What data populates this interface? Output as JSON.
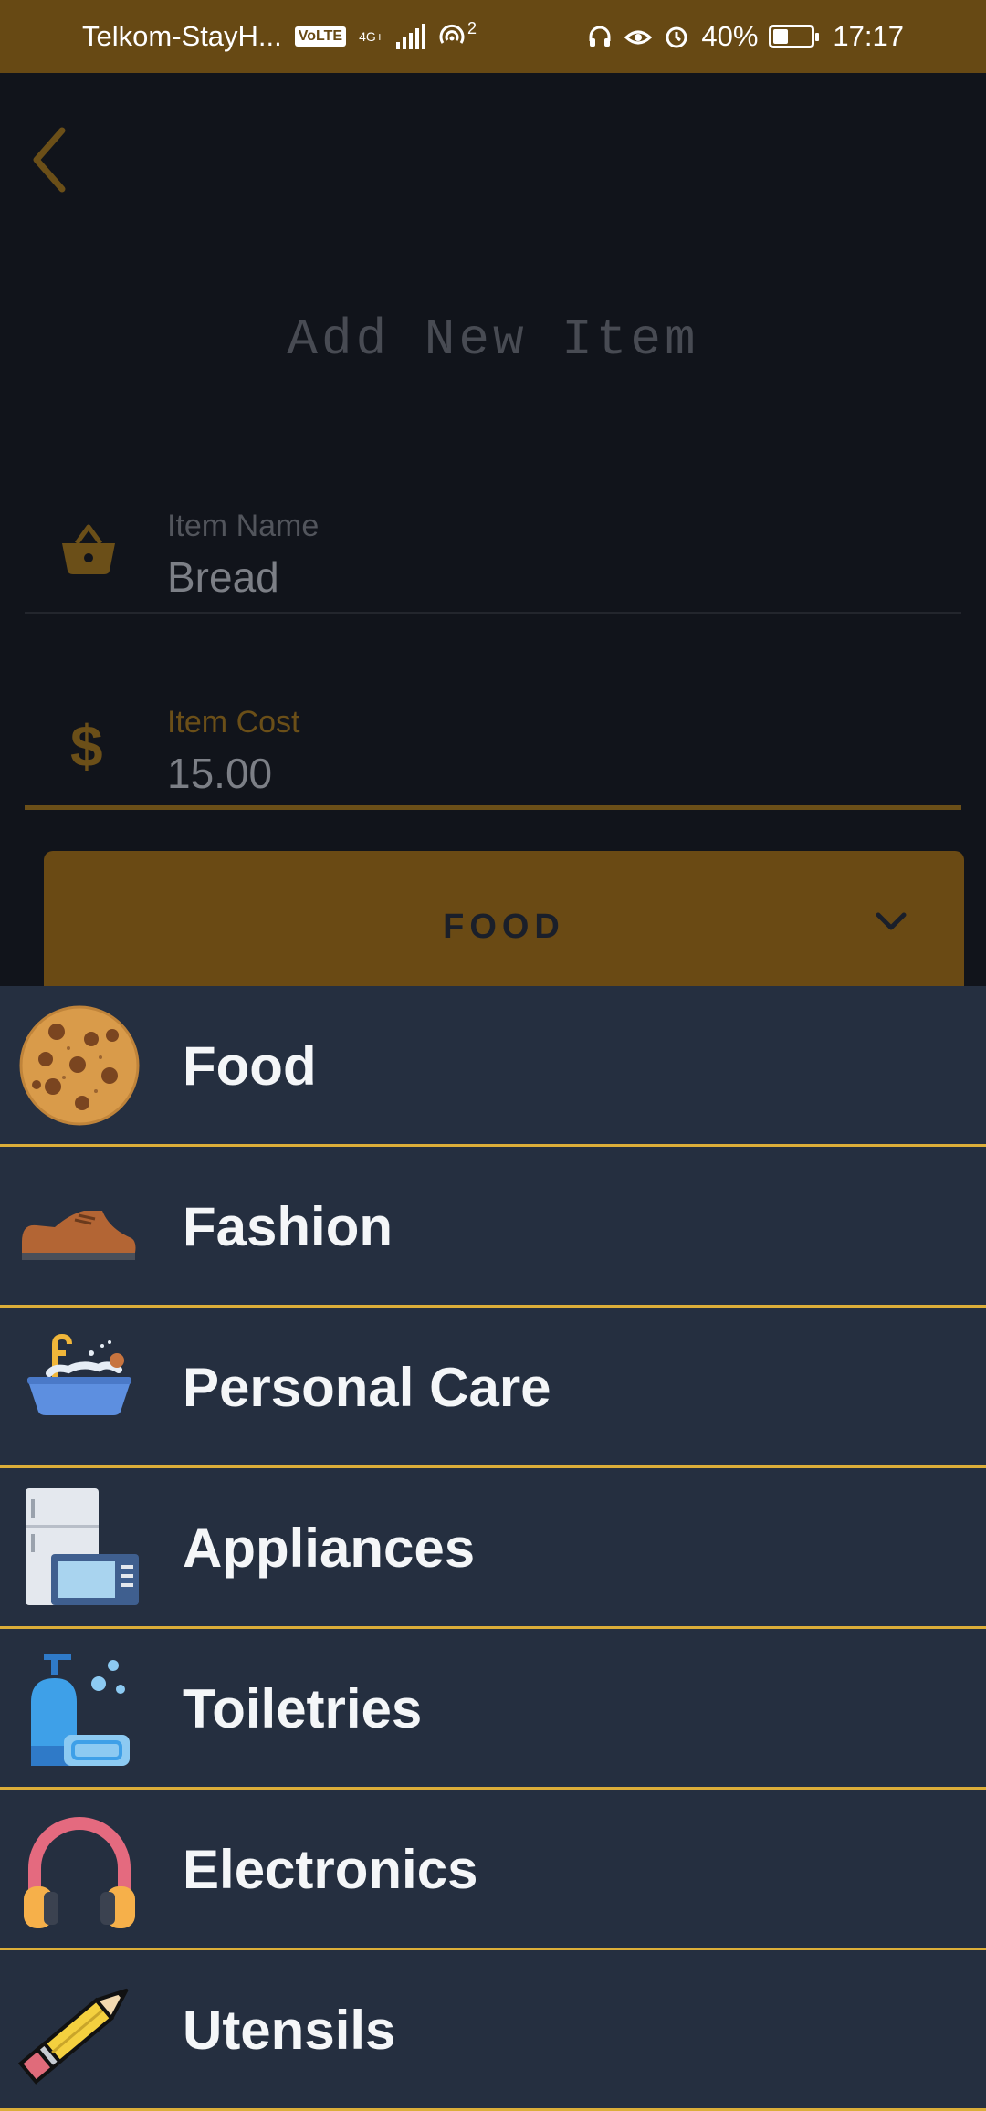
{
  "status_bar": {
    "carrier": "Telkom-StayH...",
    "volte": "VoLTE",
    "network": "4G+",
    "hotspot_count": "2",
    "battery": "40%",
    "battery_level": 0.4,
    "time": "17:17"
  },
  "page": {
    "title": "Add New Item"
  },
  "form": {
    "item_name": {
      "label": "Item Name",
      "value": "Bread",
      "icon": "basket-icon"
    },
    "item_cost": {
      "label": "Item Cost",
      "value": "15.00",
      "icon": "dollar-icon",
      "symbol": "$"
    }
  },
  "category_dropdown": {
    "selected": "FOOD"
  },
  "categories": [
    {
      "label": "Food",
      "icon": "cookie-icon"
    },
    {
      "label": "Fashion",
      "icon": "shoe-icon"
    },
    {
      "label": "Personal Care",
      "icon": "wash-basin-icon"
    },
    {
      "label": "Appliances",
      "icon": "fridge-microwave-icon"
    },
    {
      "label": "Toiletries",
      "icon": "soap-dispenser-icon"
    },
    {
      "label": "Electronics",
      "icon": "headphones-icon"
    },
    {
      "label": "Utensils",
      "icon": "pencil-icon"
    }
  ],
  "colors": {
    "accent": "#dcae39",
    "status_bar": "#674914",
    "background": "#11141b",
    "menu": "#252f40"
  }
}
